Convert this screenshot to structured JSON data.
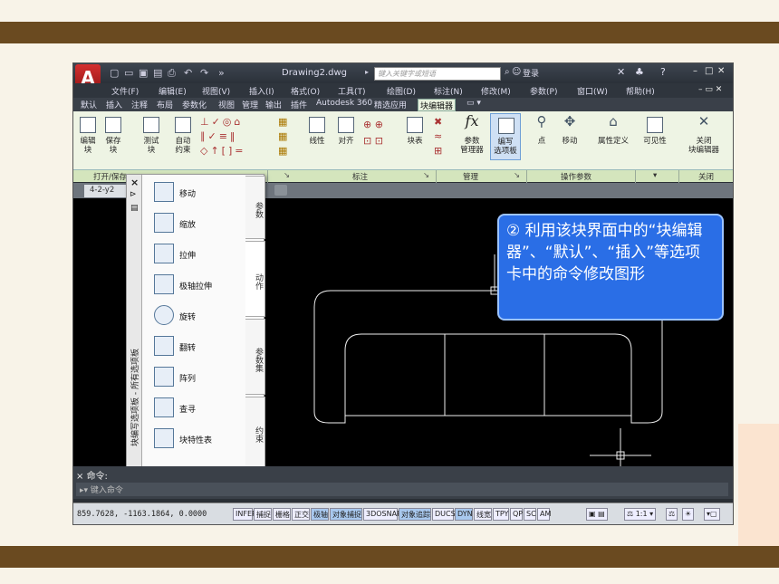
{
  "app": {
    "document_title": "Drawing2.dwg",
    "search_placeholder": "键入关键字或短语",
    "login": "登录"
  },
  "menu": [
    "文件(F)",
    "编辑(E)",
    "视图(V)",
    "插入(I)",
    "格式(O)",
    "工具(T)",
    "绘图(D)",
    "标注(N)",
    "修改(M)",
    "参数(P)",
    "窗口(W)",
    "帮助(H)"
  ],
  "tabs": [
    "默认",
    "插入",
    "注释",
    "布局",
    "参数化",
    "视图",
    "管理",
    "输出",
    "插件",
    "Autodesk 360",
    "精选应用",
    "块编辑器"
  ],
  "active_tab": "块编辑器",
  "ribbon": {
    "buttons": {
      "edit_block": "编辑\n块",
      "save_block": "保存\n块",
      "test_block": "测试\n块",
      "auto_constrain": "自动\n约束",
      "linear": "线性",
      "aligned": "对齐",
      "block_table": "块表",
      "param_manager": "参数\n管理器",
      "authoring_palettes": "编写\n选项板",
      "point": "点",
      "move": "移动",
      "attr_def": "属性定义",
      "visibility": "可见性",
      "close_editor": "关闭\n块编辑器"
    },
    "panels": [
      "打开/保存",
      "标注",
      "管理",
      "操作参数",
      "关闭"
    ]
  },
  "doc_tab": "4-2-y2",
  "palette": {
    "title": "块编写选项板 - 所有选项板",
    "items": [
      "移动",
      "缩放",
      "拉伸",
      "极轴拉伸",
      "旋转",
      "翻转",
      "阵列",
      "查寻",
      "块特性表"
    ],
    "side_tabs": [
      "参数",
      "动作",
      "参数集",
      "约束"
    ]
  },
  "callout": "② 利用该块界面中的“块编辑器”、“默认”、“插入”等选项卡中的命令修改图形",
  "command": {
    "label": "命令:",
    "placeholder": "键入命令"
  },
  "status": {
    "coords": "859.7628, -1163.1864, 0.0000",
    "buttons": [
      "INFER",
      "捕捉",
      "栅格",
      "正交",
      "极轴",
      "对象捕捉",
      "3DOSNAP",
      "对象追踪",
      "DUCS",
      "DYN",
      "线宽",
      "TPY",
      "QP",
      "SC",
      "AM"
    ],
    "active": [
      "极轴",
      "对象捕捉",
      "对象追踪",
      "DYN"
    ],
    "scale": "1:1"
  },
  "colors": {
    "band": "#6a4a20",
    "canvas": "#000000",
    "callout": "#2a6ee6",
    "ribbon": "#eef4e4"
  }
}
